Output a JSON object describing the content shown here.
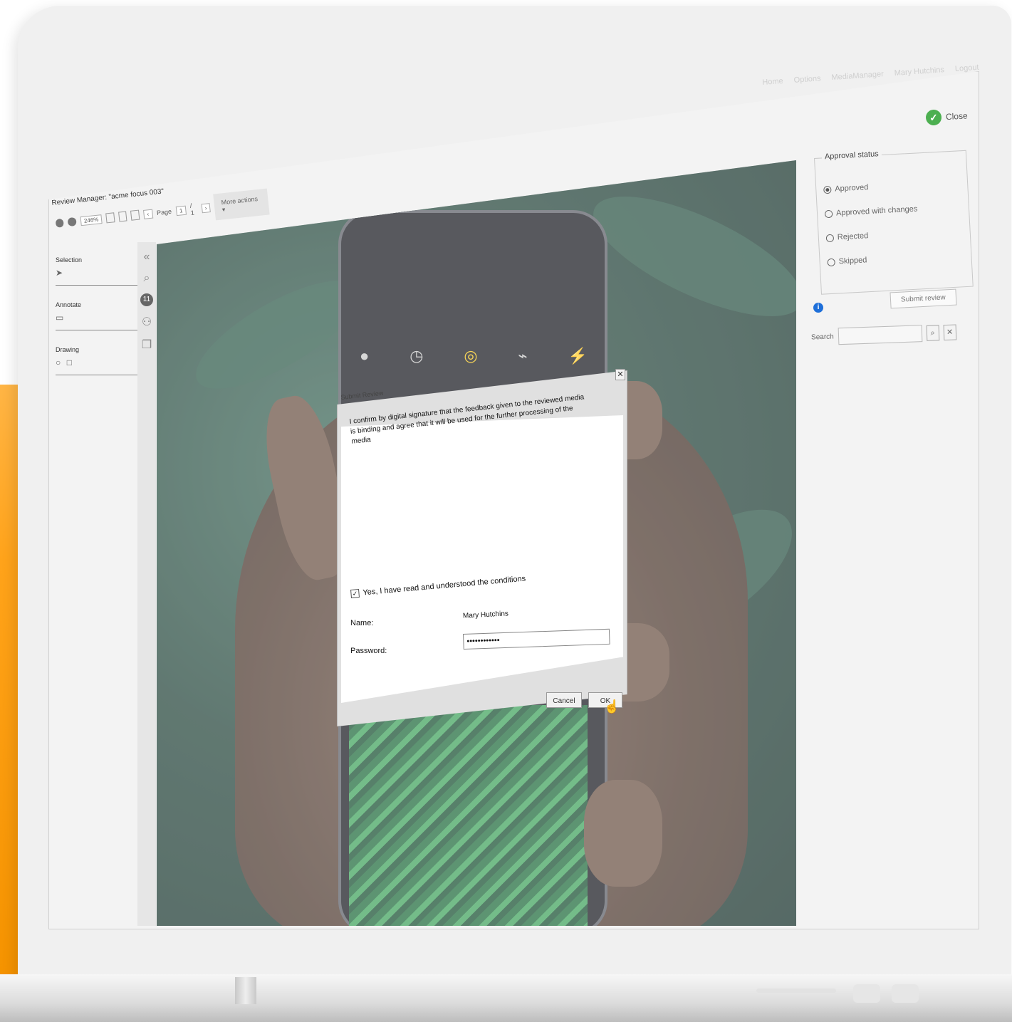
{
  "window": {
    "title": "Review Manager: \"acme focus 003\"",
    "close_label": "Close"
  },
  "top_nav": {
    "items": [
      "Home",
      "Options",
      "MediaManager",
      "Mary Hutchins",
      "Logout"
    ]
  },
  "toolbar": {
    "zoom": "246%",
    "page_label": "Page",
    "page_value": "1",
    "page_total": "/ 1",
    "more_actions": "More actions"
  },
  "tools": {
    "selection": "Selection",
    "annotate": "Annotate",
    "drawing": "Drawing"
  },
  "side_strip": {
    "comment_count": "11"
  },
  "approval": {
    "legend": "Approval status",
    "options": [
      "Approved",
      "Approved with changes",
      "Rejected",
      "Skipped"
    ],
    "selected": "Approved",
    "submit_label": "Submit review",
    "search_label": "Search",
    "search_value": ""
  },
  "dialog": {
    "title": "Submit Review",
    "confirm_text": "I confirm by digital signature that the feedback given to the reviewed media is binding and agree that it will be used for the further processing of the media",
    "accept_label": "Yes, I have read and understood the conditions",
    "accept_checked": true,
    "name_label": "Name:",
    "name_value": "Mary Hutchins",
    "password_label": "Password:",
    "password_value": "••••••••••••",
    "cancel_label": "Cancel",
    "ok_label": "OK"
  },
  "colors": {
    "accent_orange": "#ffa31a",
    "check_green": "#4caf50",
    "info_blue": "#1e6fd9"
  }
}
